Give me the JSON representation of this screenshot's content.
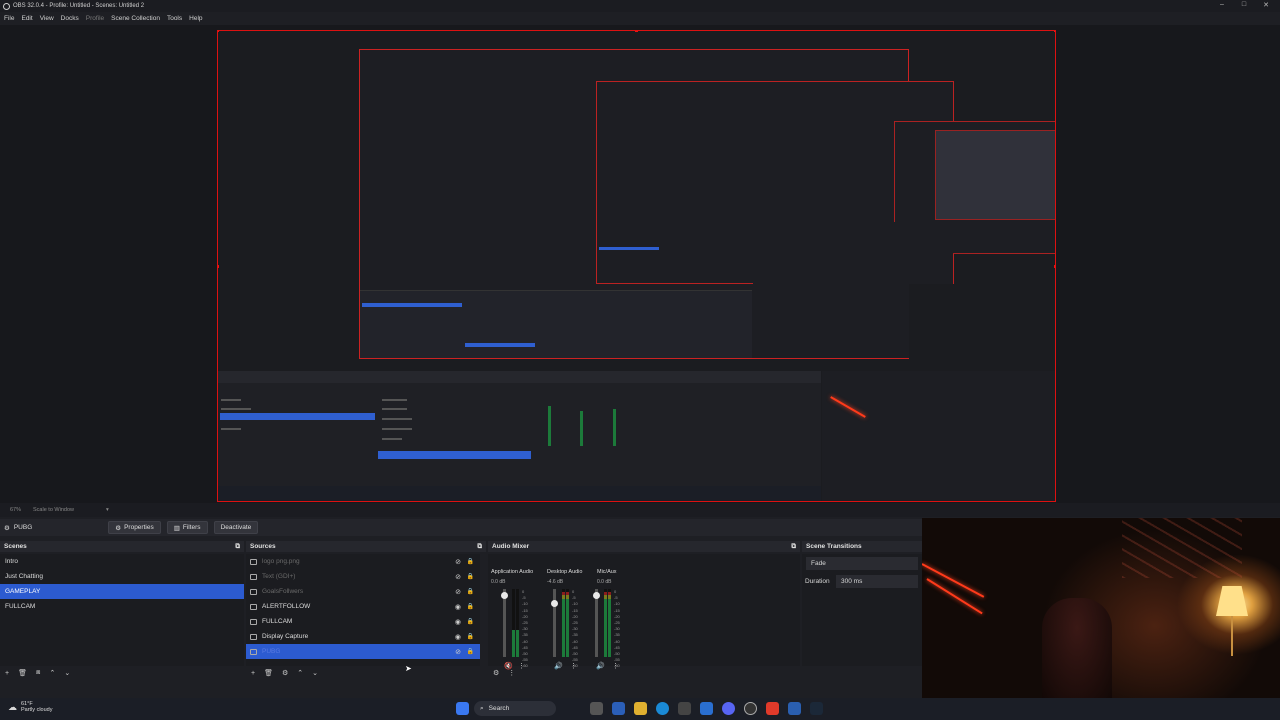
{
  "window": {
    "title": "OBS 32.0.4 - Profile: Untitled - Scenes: Untitled 2"
  },
  "menu": [
    "File",
    "Edit",
    "View",
    "Docks",
    "Profile",
    "Scene Collection",
    "Tools",
    "Help"
  ],
  "zoombar": {
    "zoom": "67%",
    "mode": "Scale to Window"
  },
  "source_toolbar": {
    "source_name": "PUBG",
    "properties": "Properties",
    "filters": "Filters",
    "deactivate": "Deactivate"
  },
  "scenes": {
    "title": "Scenes",
    "items": [
      "Intro",
      "Just Chatting",
      "GAMEPLAY",
      "FULLCAM"
    ],
    "selected": "GAMEPLAY"
  },
  "sources": {
    "title": "Sources",
    "items": [
      {
        "name": "logo png.png",
        "visible": false
      },
      {
        "name": "Text (GDI+)",
        "visible": false
      },
      {
        "name": "GoalsFollwers",
        "visible": false
      },
      {
        "name": "ALERTFOLLOW",
        "visible": true
      },
      {
        "name": "FULLCAM",
        "visible": true
      },
      {
        "name": "Display Capture",
        "visible": true
      },
      {
        "name": "PUBG",
        "visible": false
      }
    ],
    "selected": "PUBG"
  },
  "audio_mixer": {
    "title": "Audio Mixer",
    "channels": [
      {
        "name": "Application Audio",
        "db": "0.0 dB",
        "fader": 0.95
      },
      {
        "name": "Desktop Audio",
        "db": "-4.6 dB",
        "fader": 0.82
      },
      {
        "name": "Mic/Aux",
        "db": "0.0 dB",
        "fader": 0.95
      }
    ],
    "scale": [
      "0",
      "-5",
      "-10",
      "-15",
      "-20",
      "-25",
      "-30",
      "-35",
      "-40",
      "-45",
      "-50",
      "-55",
      "-60"
    ]
  },
  "scene_transitions": {
    "title": "Scene Transitions",
    "transition": "Fade",
    "duration_label": "Duration",
    "duration_value": "300 ms"
  },
  "taskbar": {
    "weather_temp": "61°F",
    "weather_text": "Partly cloudy",
    "search_placeholder": "Search"
  },
  "colors": {
    "accent": "#2c5bd0",
    "preview_border": "#dd1111",
    "background": "#1e1f24"
  }
}
